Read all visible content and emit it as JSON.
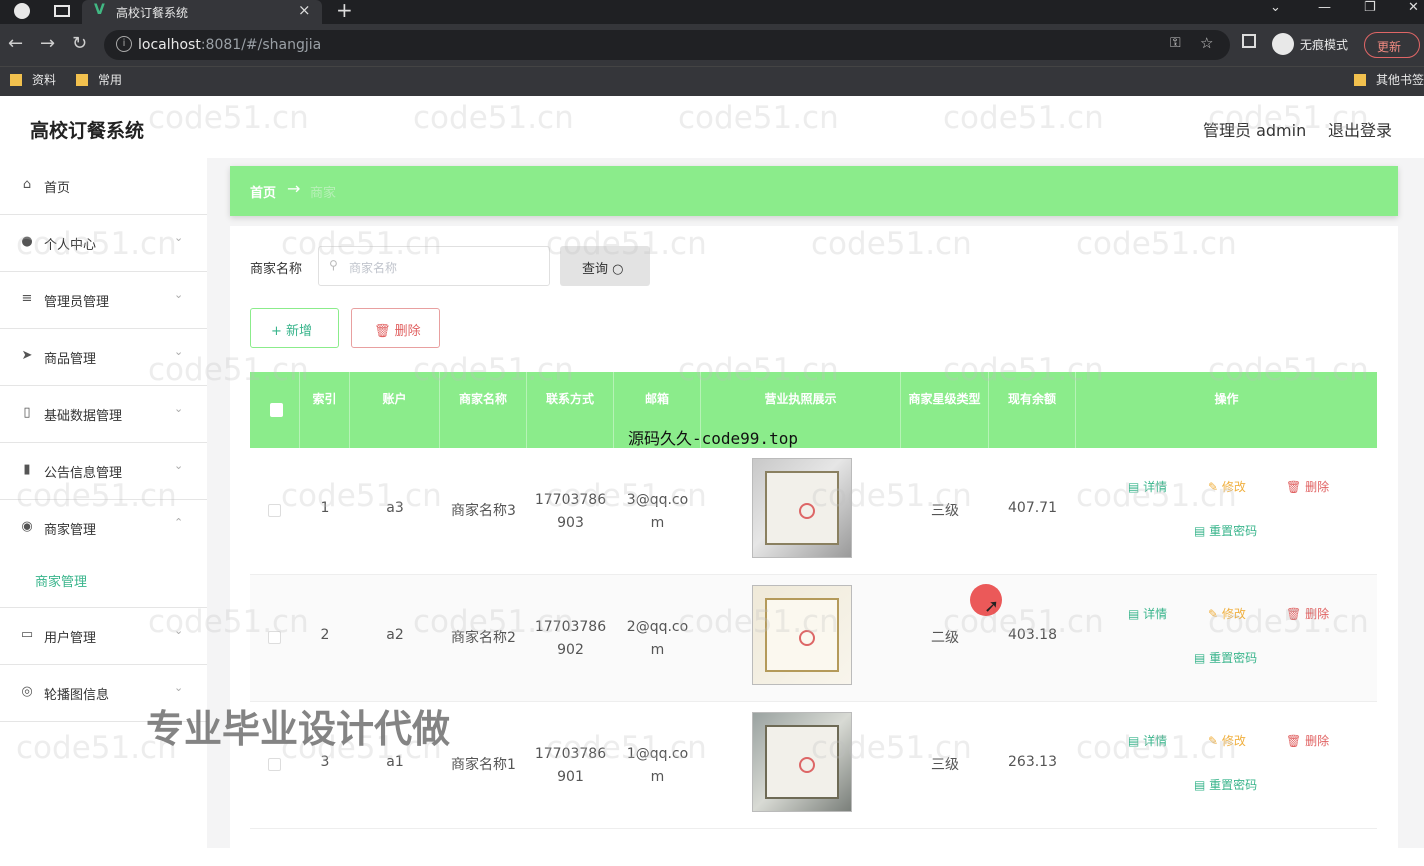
{
  "browser": {
    "tab_title": "高校订餐系统",
    "url_host": "localhost",
    "url_rest": ":8081/#/shangjia",
    "incognito_label": "无痕模式",
    "update_label": "更新",
    "bookmarks": [
      "资料",
      "常用",
      "其他书签"
    ]
  },
  "app": {
    "title": "高校订餐系统",
    "admin_label": "管理员 admin",
    "logout_label": "退出登录"
  },
  "sidebar": {
    "items": [
      {
        "label": "首页",
        "icon": "home-icon"
      },
      {
        "label": "个人中心",
        "icon": "user-icon"
      },
      {
        "label": "管理员管理",
        "icon": "list-icon"
      },
      {
        "label": "商品管理",
        "icon": "send-icon"
      },
      {
        "label": "基础数据管理",
        "icon": "battery-icon"
      },
      {
        "label": "公告信息管理",
        "icon": "chart-icon"
      },
      {
        "label": "商家管理",
        "icon": "location-icon"
      },
      {
        "label": "用户管理",
        "icon": "id-card-icon"
      },
      {
        "label": "轮播图信息",
        "icon": "compass-icon"
      }
    ],
    "submenu": "商家管理"
  },
  "breadcrumb": {
    "home": "首页",
    "arrow": "→",
    "current": "商家"
  },
  "search": {
    "label": "商家名称",
    "placeholder": "商家名称",
    "query_label": "查询"
  },
  "actions": {
    "add_label": "新增",
    "delete_label": "删除"
  },
  "table": {
    "headers": [
      "索引",
      "账户",
      "商家名称",
      "联系方式",
      "邮箱",
      "营业执照展示",
      "商家星级类型",
      "现有余额",
      "操作"
    ],
    "row_actions": {
      "detail": "详情",
      "edit": "修改",
      "remove": "删除",
      "reset": "重置密码"
    },
    "rows": [
      {
        "index": "1",
        "account": "a3",
        "name": "商家名称3",
        "phone1": "17703786",
        "phone2": "903",
        "email1": "3@qq.co",
        "email2": "m",
        "level": "三级",
        "balance": "407.71"
      },
      {
        "index": "2",
        "account": "a2",
        "name": "商家名称2",
        "phone1": "17703786",
        "phone2": "902",
        "email1": "2@qq.co",
        "email2": "m",
        "level": "二级",
        "balance": "403.18"
      },
      {
        "index": "3",
        "account": "a1",
        "name": "商家名称1",
        "phone1": "17703786",
        "phone2": "901",
        "email1": "1@qq.co",
        "email2": "m",
        "level": "三级",
        "balance": "263.13"
      }
    ]
  },
  "overlays": {
    "watermark": "code51.cn",
    "source_text": "源码久久-code99.top",
    "banner": "专业毕业设计代做"
  }
}
